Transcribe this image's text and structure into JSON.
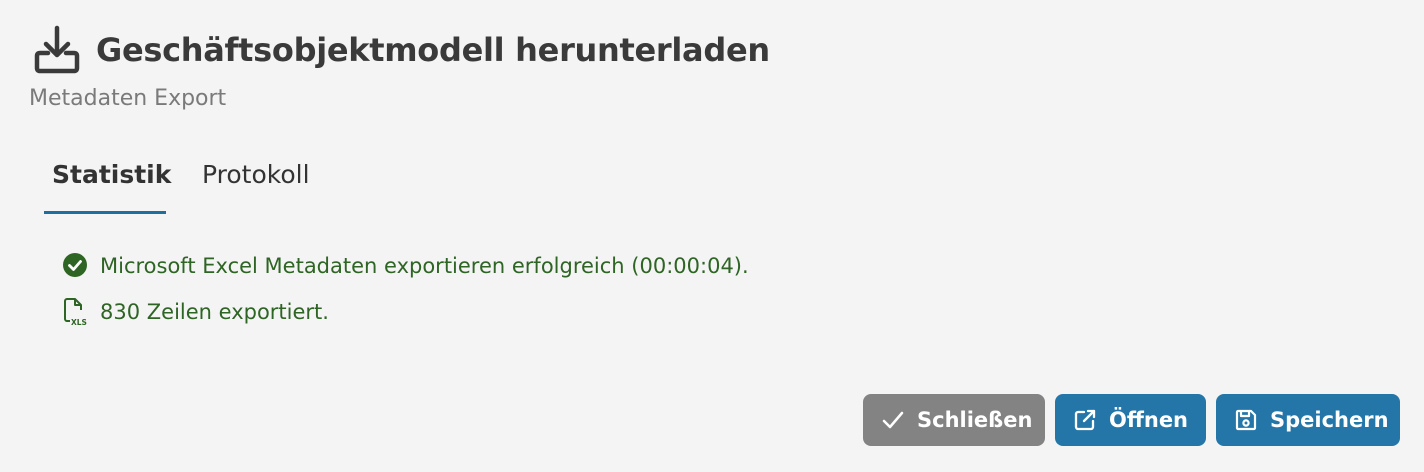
{
  "dialog": {
    "title": "Geschäftsobjektmodell herunterladen",
    "subtitle": "Metadaten Export",
    "header_icon": "download-icon"
  },
  "tabs": [
    {
      "label": "Statistik",
      "active": true
    },
    {
      "label": "Protokoll",
      "active": false
    }
  ],
  "messages": [
    {
      "icon": "check-circle-icon",
      "text": "Microsoft Excel Metadaten exportieren erfolgreich (00:00:04)."
    },
    {
      "icon": "xls-file-icon",
      "text": "830 Zeilen exportiert."
    }
  ],
  "buttons": {
    "close_label": "Schließen",
    "open_label": "Öffnen",
    "save_label": "Speichern"
  },
  "colors": {
    "accent": "#2476a8",
    "tab_underline": "#1f6f9e",
    "success_text": "#2e6524",
    "close_button": "#838383",
    "background": "#f4f4f4"
  }
}
